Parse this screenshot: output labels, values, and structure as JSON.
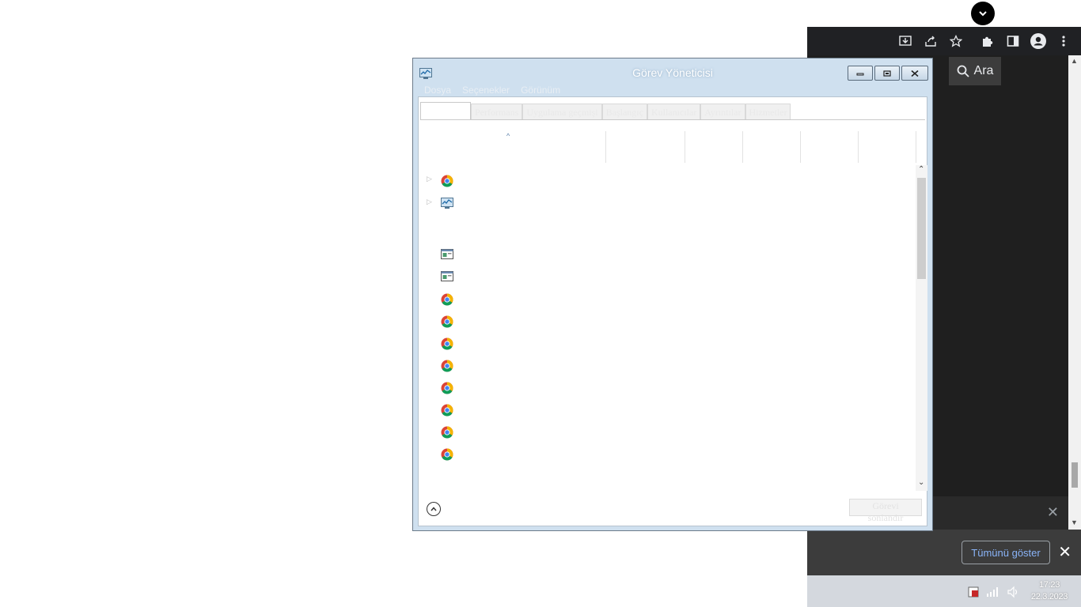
{
  "browser": {
    "search_tab_label": "Ara",
    "download_bar": {
      "show_all_label": "Tümünü göster",
      "close_icon": "close-icon"
    }
  },
  "taskbar": {
    "time": "17:23",
    "date": "22.3.2023"
  },
  "task_manager": {
    "title": "Görev Yöneticisi",
    "menu": [
      "Dosya",
      "Seçenekler",
      "Görünüm"
    ],
    "tabs": [
      "",
      "Performans",
      "Uygulama geçmişi",
      "Başlangıç",
      "Kullanıcılar",
      "Ayrıntılar",
      "Hizmetler"
    ],
    "processes": [
      {
        "icon": "chrome-icon",
        "expandable": true
      },
      {
        "icon": "task-manager-icon",
        "expandable": true
      },
      {
        "icon": "window-icon",
        "expandable": false
      },
      {
        "icon": "window-icon",
        "expandable": false
      },
      {
        "icon": "chrome-icon",
        "expandable": false
      },
      {
        "icon": "chrome-icon",
        "expandable": false
      },
      {
        "icon": "chrome-icon",
        "expandable": false
      },
      {
        "icon": "chrome-icon",
        "expandable": false
      },
      {
        "icon": "chrome-icon",
        "expandable": false
      },
      {
        "icon": "chrome-icon",
        "expandable": false
      },
      {
        "icon": "chrome-icon",
        "expandable": false
      },
      {
        "icon": "chrome-icon",
        "expandable": false
      }
    ],
    "end_task_label": "Görevi sonlandır"
  }
}
